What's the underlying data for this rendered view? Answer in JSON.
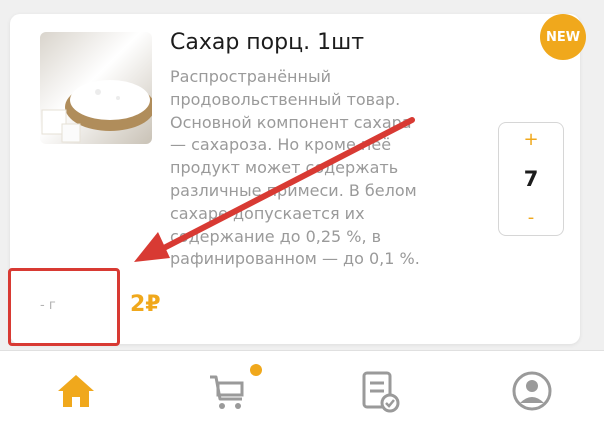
{
  "product": {
    "title": "Сахар порц. 1шт",
    "badge": "NEW",
    "description_lines": [
      "Распространённый",
      "продовольственный товар.",
      "Основной компонент сахара",
      "— сахароза. Но кроме неё",
      "продукт может содержать",
      "различные примеси. В белом",
      "сахаре допускается их",
      "содержание до 0,25 %, в",
      "рафинированном — до 0,1 %."
    ],
    "quantity": "7",
    "plus_label": "+",
    "minus_label": "-",
    "weight": "- г",
    "price": "2₽"
  },
  "nav": {
    "items": [
      {
        "name": "home",
        "icon": "home-icon",
        "active": true
      },
      {
        "name": "cart",
        "icon": "cart-icon",
        "active": false
      },
      {
        "name": "orders",
        "icon": "checklist-icon",
        "active": false
      },
      {
        "name": "profile",
        "icon": "user-icon",
        "active": false
      }
    ]
  },
  "colors": {
    "accent": "#f0a81c",
    "annotation": "#d83a33",
    "inactive_icon": "#9a9a9a"
  }
}
